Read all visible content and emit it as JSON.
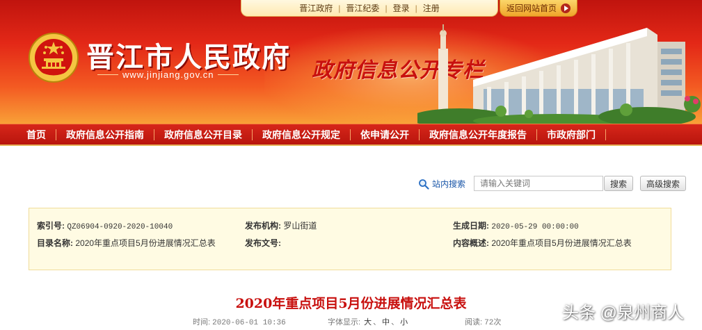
{
  "top_bar": {
    "links": [
      "晋江政府",
      "晋江纪委",
      "登录",
      "注册"
    ],
    "separator": "|",
    "back_home": "返回网站首页"
  },
  "header": {
    "site_title": "晋江市人民政府",
    "site_url": "www.jinjiang.gov.cn",
    "slogan": "政府信息公开专栏"
  },
  "nav": {
    "items": [
      "首页",
      "政府信息公开指南",
      "政府信息公开目录",
      "政府信息公开规定",
      "依申请公开",
      "政府信息公开年度报告",
      "市政府部门"
    ]
  },
  "search": {
    "label": "站内搜索",
    "placeholder": "请输入关键词",
    "search_button": "搜索",
    "advanced_button": "高级搜索"
  },
  "info": {
    "index_label": "索引号:",
    "index_value": "QZ06904-0920-2020-10040",
    "publisher_label": "发布机构:",
    "publisher_value": "罗山街道",
    "date_label": "生成日期:",
    "date_value": "2020-05-29 00:00:00",
    "catalog_label": "目录名称:",
    "catalog_value": "2020年重点项目5月份进展情况汇总表",
    "docno_label": "发布文号:",
    "docno_value": "",
    "summary_label": "内容概述:",
    "summary_value": "2020年重点项目5月份进展情况汇总表"
  },
  "article": {
    "title": "2020年重点项目5月份进展情况汇总表",
    "time_label": "时间:",
    "time_value": "2020-06-01 10:36",
    "font_label": "字体显示:",
    "font_large": "大",
    "font_medium": "中",
    "font_small": "小",
    "font_sep": "、",
    "views_label": "阅读:",
    "views_value": "72次"
  },
  "watermark": "头条 @泉州商人",
  "colors": {
    "header_red": "#e32817",
    "nav_red": "#c81b12",
    "title_red": "#c8100e",
    "info_bg": "#fffbe3",
    "link_blue": "#1a56a8"
  }
}
